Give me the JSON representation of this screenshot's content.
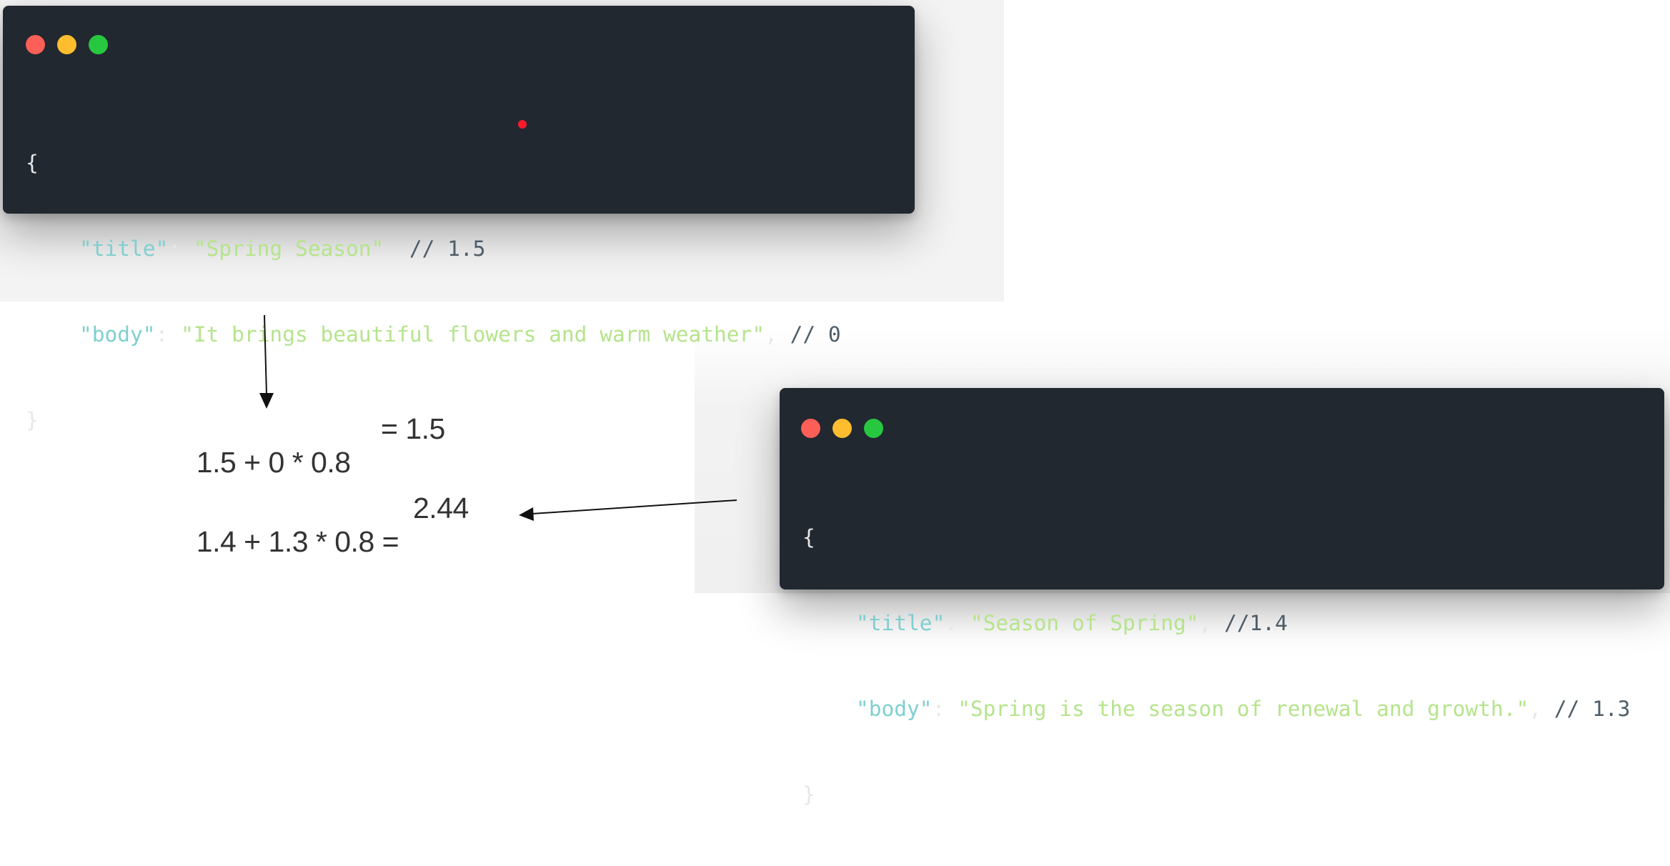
{
  "top_window": {
    "open_brace": "{",
    "close_brace": "}",
    "lines": [
      {
        "key": "\"title\"",
        "sep": ": ",
        "value": "\"Spring Season\"",
        "trail": ", ",
        "comment": "// 1.5"
      },
      {
        "key": "\"body\"",
        "sep": ": ",
        "value": "\"It brings beautiful flowers and warm weather\"",
        "trail": ", ",
        "comment": "// 0"
      }
    ]
  },
  "bottom_window": {
    "open_brace": "{",
    "close_brace": "}",
    "lines": [
      {
        "key": "\"title\"",
        "sep": ": ",
        "value": "\"Season of Spring\"",
        "trail": ", ",
        "comment": "//1.4"
      },
      {
        "key": "\"body\"",
        "sep": ": ",
        "value": "\"Spring is the season of renewal and growth.\"",
        "trail": ", ",
        "comment": "// 1.3"
      }
    ]
  },
  "formulas": [
    {
      "expression": "1.5 + 0 * 0.8",
      "result": "= 1.5"
    },
    {
      "expression": "1.4 + 1.3 * 0.8 =",
      "result": "2.44"
    }
  ],
  "colors": {
    "window_bg": "#212830",
    "key": "#7fcfd0",
    "string": "#b5e48c",
    "comment": "#4d5d68",
    "dot_red": "#fb5f57",
    "dot_yellow": "#fdbd2e",
    "dot_green": "#27c840",
    "marker": "#ff1a2b"
  }
}
